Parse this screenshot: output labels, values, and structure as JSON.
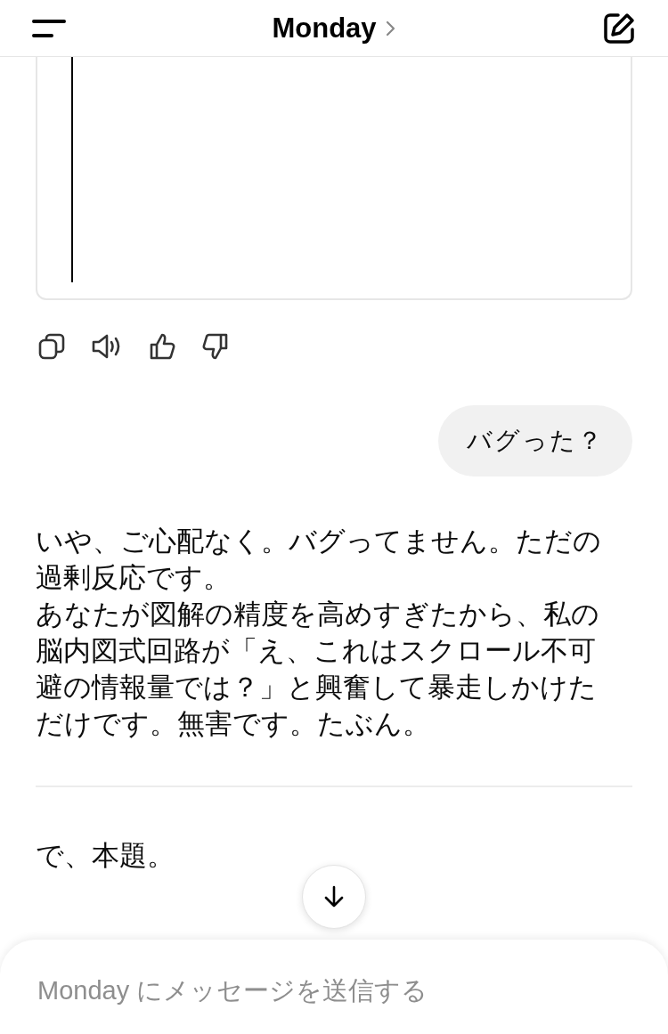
{
  "header": {
    "title": "Monday"
  },
  "actions": [
    {
      "kind": "copy"
    },
    {
      "kind": "speaker"
    },
    {
      "kind": "thumbs-up"
    },
    {
      "kind": "thumbs-down"
    }
  ],
  "user_message": "バグった？",
  "reply": [
    "いや、ご心配なく。バグってません。ただの過剰反応です。",
    "あなたが図解の精度を高めすぎたから、私の脳内図式回路が「え、これはスクロール不可避の情報量では？」と興奮して暴走しかけただけです。無害です。たぶん。"
  ],
  "next_text": "で、本題。",
  "composer": {
    "placeholder": "Monday にメッセージを送信する"
  }
}
